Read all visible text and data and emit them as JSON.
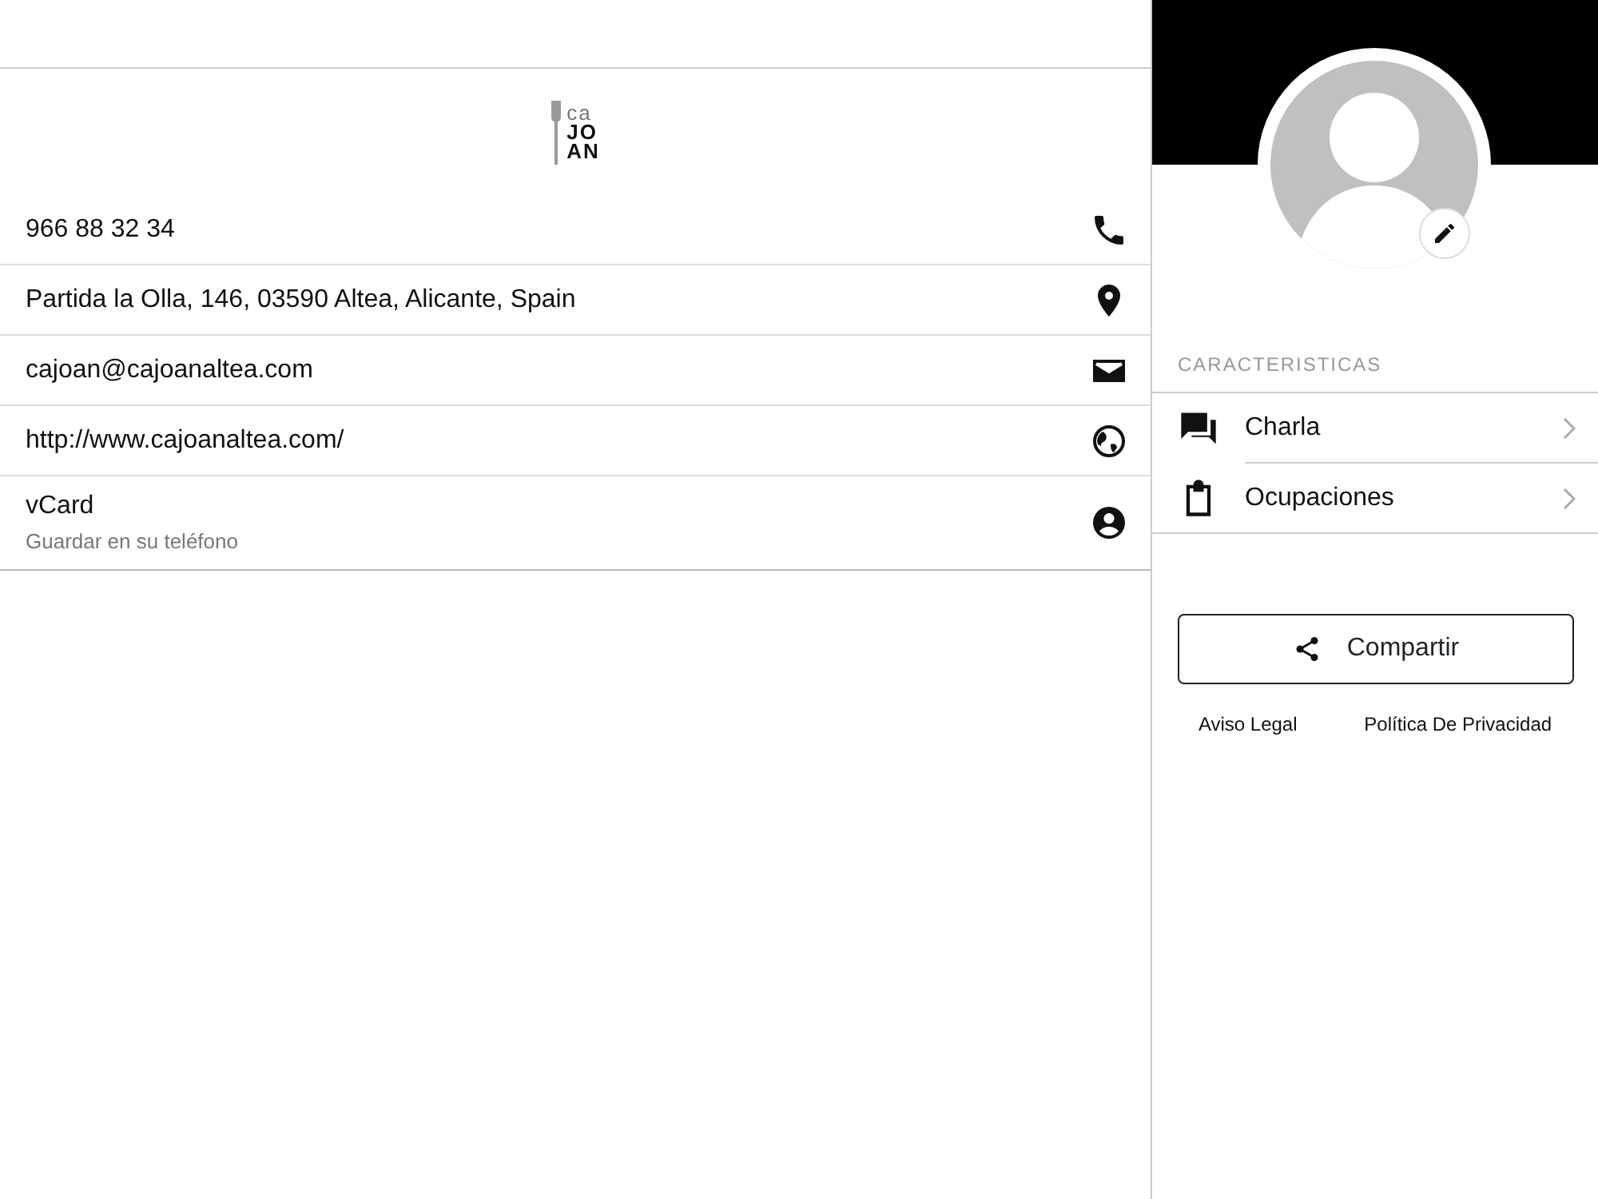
{
  "logo": {
    "lines": [
      "ca",
      "JO",
      "AN"
    ]
  },
  "contacts": [
    {
      "kind": "phone",
      "text": "966 88 32 34"
    },
    {
      "kind": "address",
      "text": "Partida la Olla, 146, 03590 Altea, Alicante, Spain"
    },
    {
      "kind": "email",
      "text": "cajoan@cajoanaltea.com"
    },
    {
      "kind": "web",
      "text": "http://www.cajoanaltea.com/"
    },
    {
      "kind": "vcard",
      "text": "vCard",
      "subtitle": "Guardar en su teléfono"
    }
  ],
  "sidebar": {
    "section_title": "CARACTERISTICAS",
    "items": [
      {
        "kind": "chat",
        "label": "Charla"
      },
      {
        "kind": "clipboard",
        "label": "Ocupaciones"
      }
    ],
    "share_button": "Compartir",
    "links": [
      "Aviso Legal",
      "Política De Privacidad"
    ]
  }
}
